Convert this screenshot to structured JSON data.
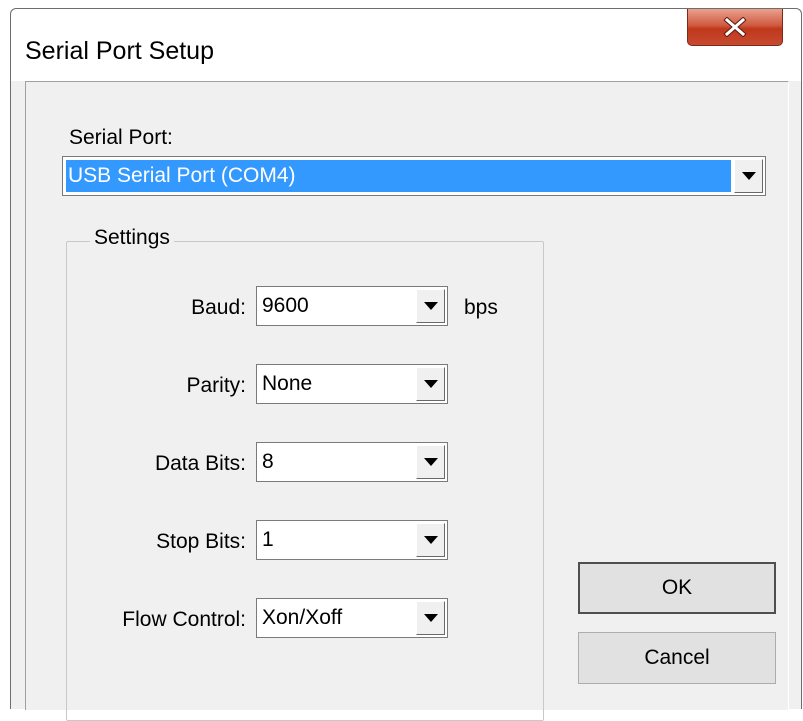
{
  "window": {
    "title": "Serial Port Setup"
  },
  "serial_port": {
    "label": "Serial Port:",
    "value": "USB Serial Port (COM4)"
  },
  "settings": {
    "group_label": "Settings",
    "baud": {
      "label": "Baud:",
      "value": "9600",
      "unit": "bps"
    },
    "parity": {
      "label": "Parity:",
      "value": "None"
    },
    "data_bits": {
      "label": "Data Bits:",
      "value": "8"
    },
    "stop_bits": {
      "label": "Stop Bits:",
      "value": "1"
    },
    "flow_control": {
      "label": "Flow Control:",
      "value": "Xon/Xoff"
    }
  },
  "buttons": {
    "ok": "OK",
    "cancel": "Cancel"
  },
  "icons": {
    "close": "close-icon",
    "dropdown": "chevron-down-icon"
  },
  "colors": {
    "selection": "#3399ff",
    "close_button": "#c7432a"
  }
}
